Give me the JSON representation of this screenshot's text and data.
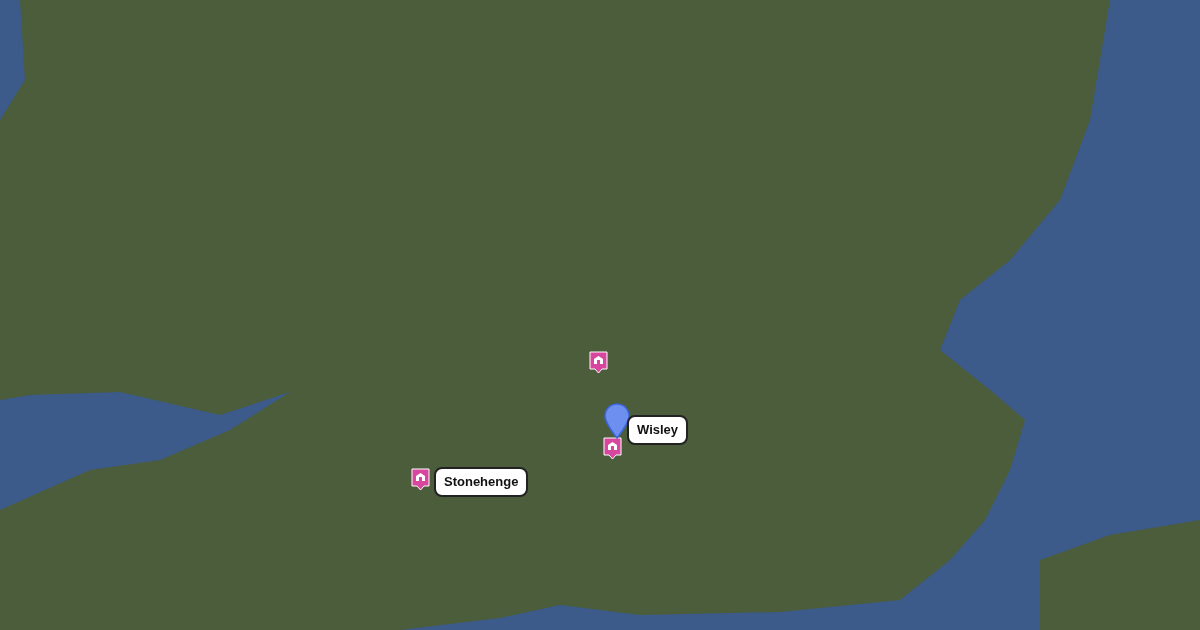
{
  "map": {
    "markers": [
      {
        "kind": "attraction"
      },
      {
        "kind": "attraction",
        "label": "Stonehenge"
      },
      {
        "kind": "attraction"
      },
      {
        "kind": "pin",
        "label": "Wisley"
      }
    ]
  }
}
